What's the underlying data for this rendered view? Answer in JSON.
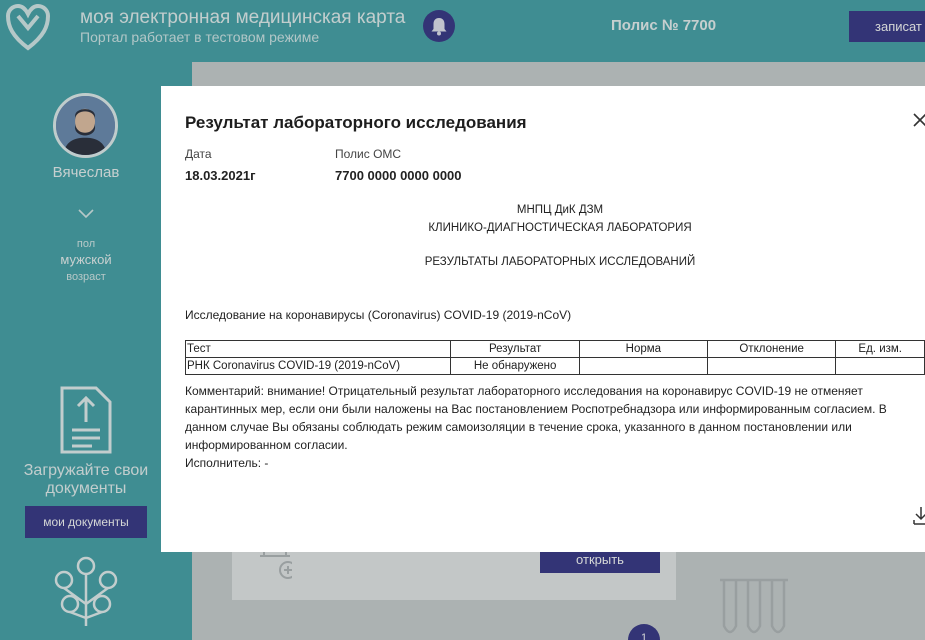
{
  "header": {
    "title": "моя электронная медицинская карта",
    "subtitle": "Портал работает в тестовом режиме",
    "polis": "Полис № 7700",
    "signup_button": "записат"
  },
  "sidebar": {
    "user_name": "Вячеслав",
    "sex_label": "пол",
    "sex_value": "мужской",
    "age_label": "возраст",
    "upload_text": "Загружайте свои документы",
    "my_docs_button": "мои документы"
  },
  "background": {
    "open_button": "открыть",
    "page_number": "1"
  },
  "modal": {
    "title": "Результат лабораторного исследования",
    "date_label": "Дата",
    "date_value": "18.03.2021г",
    "polis_label": "Полис ОМС",
    "polis_value": "7700 0000 0000 0000",
    "org_line1": "МНПЦ ДиК ДЗМ",
    "org_line2": "КЛИНИКО-ДИАГНОСТИЧЕСКАЯ ЛАБОРАТОРИЯ",
    "org_line3": "РЕЗУЛЬТАТЫ ЛАБОРАТОРНЫХ ИССЛЕДОВАНИЙ",
    "study_title": "Исследование на коронавирусы (Coronavirus) COVID-19 (2019-nCoV)",
    "table": {
      "headers": [
        "Тест",
        "Результат",
        "Норма",
        "Отклонение",
        "Ед. изм."
      ],
      "rows": [
        [
          "РНК Coronavirus COVID-19 (2019-nCoV)",
          "Не обнаружено",
          "",
          "",
          ""
        ]
      ]
    },
    "comment": "Комментарий: внимание! Отрицательный результат лабораторного исследования на коронавирус COVID-19 не отменяет карантинных мер, если они были наложены на Вас постановлением Роспотребнадзора или информированным согласием. В данном случае Вы обязаны соблюдать режим самоизоляции в течение срока, указанного в данном постановлении или информированном согласии.",
    "executor": "Исполнитель: -"
  },
  "icons": {
    "logo": "heart-shield-icon",
    "bell": "bell-icon",
    "close": "close-icon",
    "download": "download-icon",
    "chevron": "chevron-down-icon",
    "document": "document-upload-icon",
    "family": "family-tree-icon"
  },
  "colors": {
    "teal": "#4aa7ac",
    "accent": "#3b3a8a",
    "modal_bg": "#ffffff"
  }
}
